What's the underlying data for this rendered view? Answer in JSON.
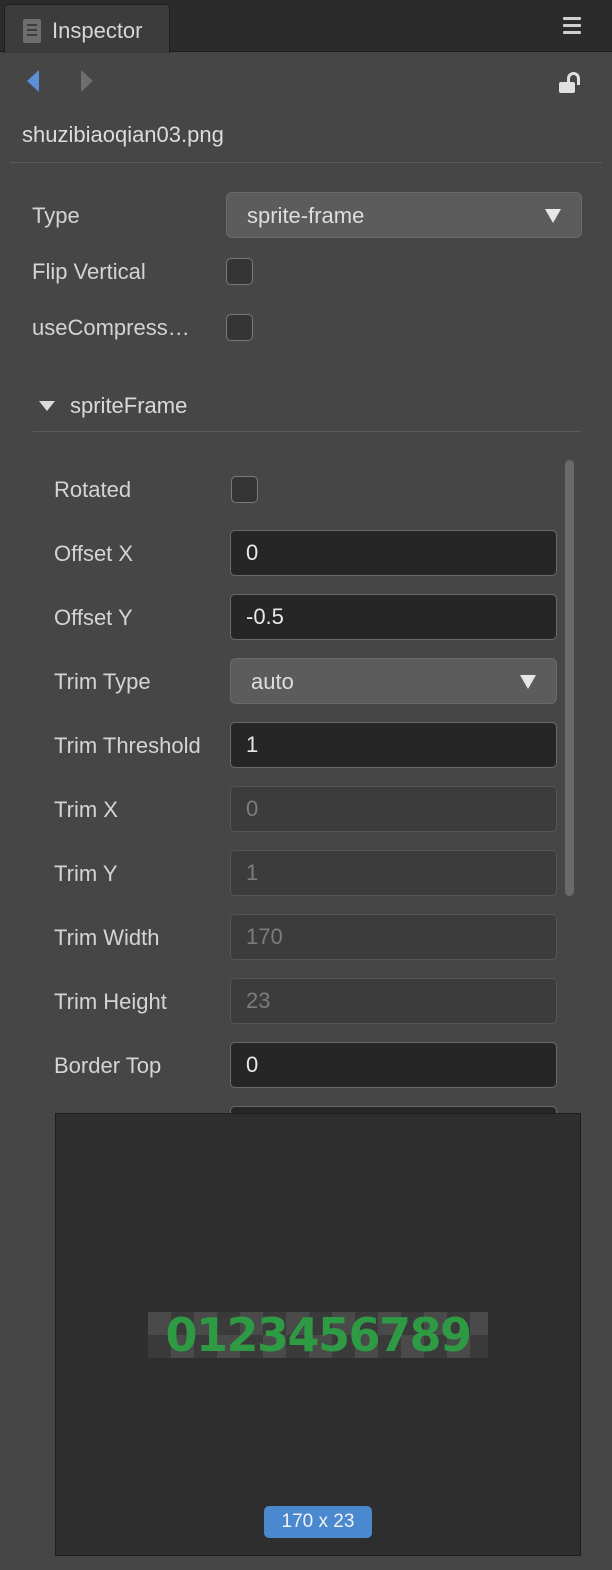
{
  "tab": {
    "title": "Inspector",
    "icon": "inspector-panel-icon"
  },
  "icons": {
    "menu": "hamburger-menu-icon",
    "back": "back-arrow-icon",
    "forward": "forward-arrow-icon",
    "lock": "unlock-icon"
  },
  "asset": {
    "filename": "shuzibiaoqian03.png"
  },
  "type": {
    "label": "Type",
    "value": "sprite-frame"
  },
  "flip_vertical": {
    "label": "Flip Vertical",
    "checked": false
  },
  "use_compress": {
    "label": "useCompress…",
    "checked": false
  },
  "sprite_frame": {
    "title": "spriteFrame",
    "expanded": true,
    "rotated": {
      "label": "Rotated",
      "checked": false
    },
    "offset_x": {
      "label": "Offset X",
      "value": "0"
    },
    "offset_y": {
      "label": "Offset Y",
      "value": "-0.5"
    },
    "trim_type": {
      "label": "Trim Type",
      "value": "auto"
    },
    "trim_threshold": {
      "label": "Trim Threshold",
      "value": "1"
    },
    "trim_x": {
      "label": "Trim X",
      "value": "0"
    },
    "trim_y": {
      "label": "Trim Y",
      "value": "1"
    },
    "trim_width": {
      "label": "Trim Width",
      "value": "170"
    },
    "trim_height": {
      "label": "Trim Height",
      "value": "23"
    },
    "border_top": {
      "label": "Border Top",
      "value": "0"
    }
  },
  "preview": {
    "sprite_text": "0123456789",
    "size": "170 x 23"
  },
  "colors": {
    "accent": "#4a88d0",
    "sprite_green": "#2e9a44",
    "panel_bg": "#464646"
  }
}
